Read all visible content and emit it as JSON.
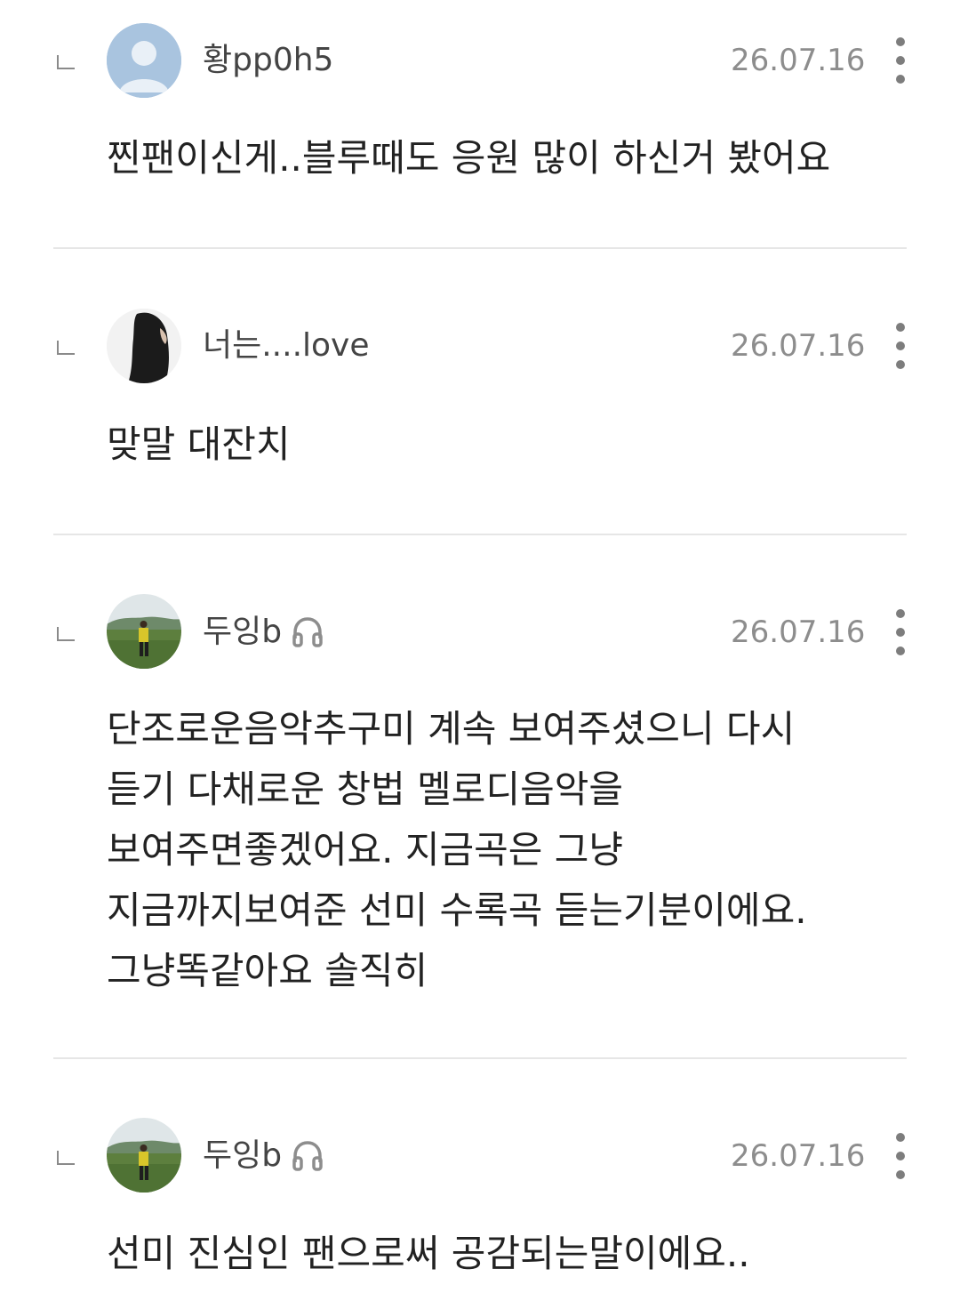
{
  "comments": [
    {
      "username": "황pp0h5",
      "date": "26.07.16",
      "avatar": "default-user-avatar",
      "has_headphone_badge": false,
      "lines": [
        "찐팬이신게..블루때도 응원 많이 하신거 봤어요"
      ]
    },
    {
      "username": "너는....love",
      "date": "26.07.16",
      "avatar": "dark-hair-photo-avatar",
      "has_headphone_badge": false,
      "lines": [
        "맞말 대잔치"
      ]
    },
    {
      "username": "두잉b",
      "date": "26.07.16",
      "avatar": "field-person-photo-avatar",
      "has_headphone_badge": true,
      "lines": [
        "단조로운음악추구미 계속 보여주셨으니 다시",
        "듣기 다채로운 창법 멜로디음악을",
        "보여주면좋겠어요. 지금곡은 그냥",
        "지금까지보여준 선미 수록곡 듣는기분이에요.",
        "그냥똑같아요 솔직히"
      ]
    },
    {
      "username": "두잉b",
      "date": "26.07.16",
      "avatar": "field-person-photo-avatar",
      "has_headphone_badge": true,
      "lines": [
        "선미 진심인 팬으로써 공감되는말이에요.."
      ]
    }
  ],
  "icons": {
    "reply": "reply-corner-icon",
    "more": "more-vertical-icon",
    "badge": "headphone-icon"
  },
  "colors": {
    "text": "#222222",
    "username": "#444444",
    "date": "#8d8d8d",
    "divider": "#e6e6e6",
    "default_avatar_bg": "#a9c4df"
  }
}
